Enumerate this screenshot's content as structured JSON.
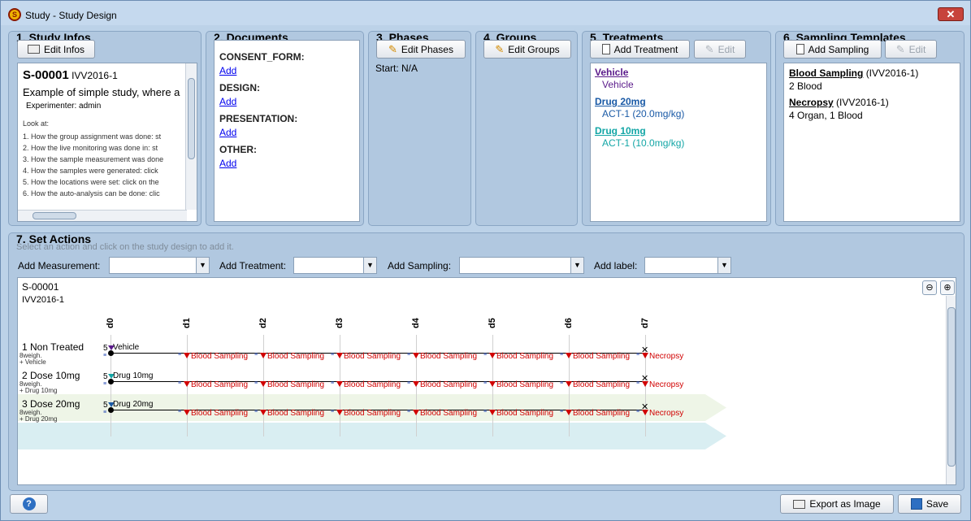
{
  "window": {
    "title": "Study - Study Design",
    "close": "✕"
  },
  "panels": {
    "study_infos": {
      "title": "1. Study Infos",
      "button": "Edit Infos",
      "study_id": "S-00001",
      "study_code": "IVV2016-1",
      "description": "Example of simple study, where a",
      "experimenter": "Experimenter: admin",
      "look_at": "Look at:",
      "lines": [
        "1. How the group assignment was done: st",
        "2. How the live monitoring was done in: st",
        "3. How the sample measurement was done",
        "4. How the samples were generated: click",
        "5. How the locations were set: click on the",
        "6. How the auto-analysis can be done: clic"
      ]
    },
    "documents": {
      "title": "2. Documents",
      "sections": [
        {
          "heading": "CONSENT_FORM:",
          "link": "Add"
        },
        {
          "heading": "DESIGN:",
          "link": "Add"
        },
        {
          "heading": "PRESENTATION:",
          "link": "Add"
        },
        {
          "heading": "OTHER:",
          "link": "Add"
        }
      ]
    },
    "phases": {
      "title": "3. Phases",
      "button": "Edit Phases",
      "start": "Start: N/A"
    },
    "groups": {
      "title": "4. Groups",
      "button": "Edit Groups"
    },
    "treatments": {
      "title": "5. Treatments",
      "add_button": "Add Treatment",
      "edit_button": "Edit",
      "items": [
        {
          "name": "Vehicle",
          "detail": "Vehicle",
          "color": "#5a1a8a"
        },
        {
          "name": "Drug 20mg",
          "detail": "ACT-1 (20.0mg/kg)",
          "color": "#1a5aa6"
        },
        {
          "name": "Drug 10mg",
          "detail": "ACT-1 (10.0mg/kg)",
          "color": "#13a6a6"
        }
      ]
    },
    "sampling": {
      "title": "6. Sampling Templates",
      "add_button": "Add Sampling",
      "edit_button": "Edit",
      "items": [
        {
          "name": "Blood Sampling",
          "code": "(IVV2016-1)",
          "detail": "2 Blood"
        },
        {
          "name": "Necropsy",
          "code": "(IVV2016-1)",
          "detail": "4 Organ, 1 Blood"
        }
      ]
    }
  },
  "actions": {
    "title": "7. Set Actions",
    "hint": "Select an action and click on the study design to add it.",
    "add_measurement": "Add Measurement:",
    "add_treatment": "Add Treatment:",
    "add_sampling": "Add Sampling:",
    "add_label": "Add label:"
  },
  "diagram": {
    "study_id": "S-00001",
    "study_code": "IVV2016-1",
    "days": [
      "d0",
      "d1",
      "d2",
      "d3",
      "d4",
      "d5",
      "d6",
      "d7"
    ],
    "groups": [
      {
        "name": "1 Non Treated",
        "sub1": "8weigh.",
        "sub2": "+ Vehicle",
        "treatment": "Vehicle",
        "count": "5",
        "band": "#ffffff",
        "dot": "#5a1a8a"
      },
      {
        "name": "2 Dose 10mg",
        "sub1": "8weigh.",
        "sub2": "+ Drug 10mg",
        "treatment": "Drug 10mg",
        "count": "5",
        "band": "#eef5e7",
        "dot": "#13a6a6"
      },
      {
        "name": "3 Dose 20mg",
        "sub1": "8weigh.",
        "sub2": "+ Drug 20mg",
        "treatment": "Drug 20mg",
        "count": "5",
        "band": "#d9eef2",
        "dot": "#1a5aa6"
      }
    ],
    "sampling_label": "Blood Sampling",
    "necropsy_label": "Necropsy"
  },
  "footer": {
    "help": "?",
    "export": "Export as Image",
    "save": "Save"
  },
  "colors": {
    "link": "#0000ee",
    "sampling": "#d10000"
  }
}
